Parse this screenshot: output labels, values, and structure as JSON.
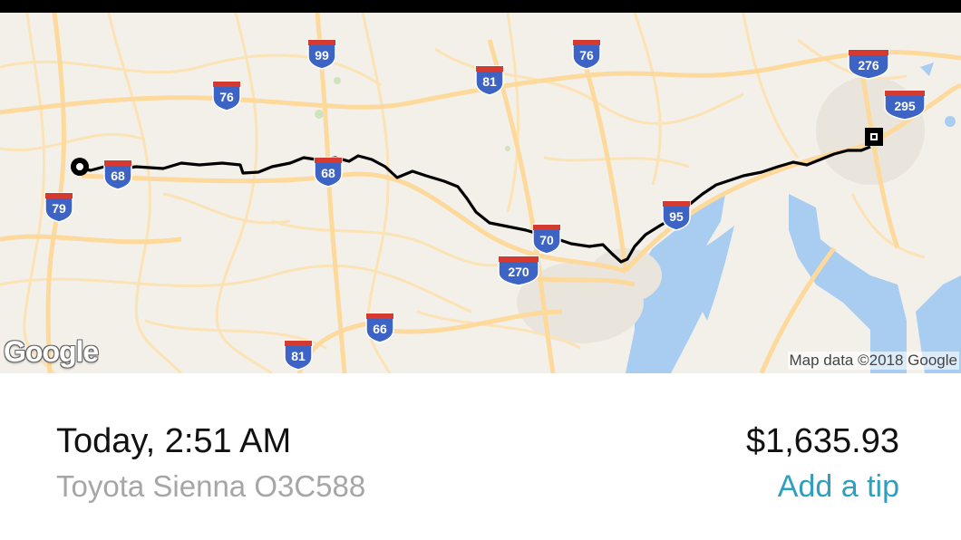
{
  "map": {
    "logo": "Google",
    "attribution": "Map data ©2018 Google",
    "shields": [
      "99",
      "76",
      "81",
      "76",
      "276",
      "295",
      "68",
      "79",
      "68",
      "70",
      "270",
      "95",
      "66",
      "81"
    ],
    "route": {
      "start": "origin",
      "end": "destination"
    }
  },
  "trip": {
    "datetime": "Today, 2:51 AM",
    "vehicle": "Toyota Sienna O3C588",
    "fare": "$1,635.93",
    "tip_label": "Add a tip"
  },
  "colors": {
    "highway": "#fdd99b",
    "water": "#9ec6ee",
    "shield": "#3d64c4",
    "route": "#000000",
    "tip": "#2e9fc0"
  }
}
